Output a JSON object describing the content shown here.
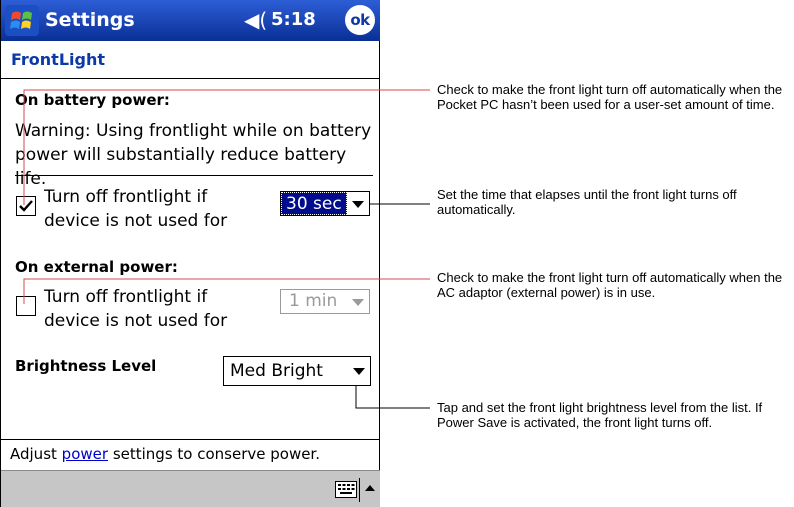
{
  "titlebar": {
    "app_title": "Settings",
    "icon": "windows-flag-icon",
    "volume_icon": "speaker-icon",
    "time": "5:18",
    "ok_label": "ok"
  },
  "page": {
    "title": "FrontLight"
  },
  "battery": {
    "heading": "On battery power:",
    "warning": "Warning: Using frontlight while on battery power will substantially reduce battery life.",
    "checkbox_label": "Turn off frontlight if device is not used for",
    "checked": true,
    "timeout_value": "30 sec"
  },
  "external": {
    "heading": "On external power:",
    "checkbox_label": "Turn off frontlight if device is not used for",
    "checked": false,
    "timeout_value": "1 min"
  },
  "brightness": {
    "label": "Brightness Level",
    "value": "Med Bright"
  },
  "footer": {
    "prefix": "Adjust ",
    "link": "power",
    "suffix": " settings to conserve power."
  },
  "taskbar": {
    "keyboard_icon": "keyboard-icon",
    "sip_arrow_icon": "up-arrow-icon"
  },
  "captions": {
    "c1": "Check to make the front light turn off automatically when the Pocket PC hasn’t been used for a user-set amount of time.",
    "c2": "Set the time that elapses until the front light turns off automatically.",
    "c3": "Check to make the front light turn off automatically when the AC adaptor (external power) is in use.",
    "c4": "Tap and set the front light brightness level from the list. If Power Save is activated, the front light turns off."
  },
  "colors": {
    "titlebar": "#0b3aa8",
    "selection": "#000c8c",
    "link": "#0000cc",
    "taskbar": "#c6c6c6"
  }
}
